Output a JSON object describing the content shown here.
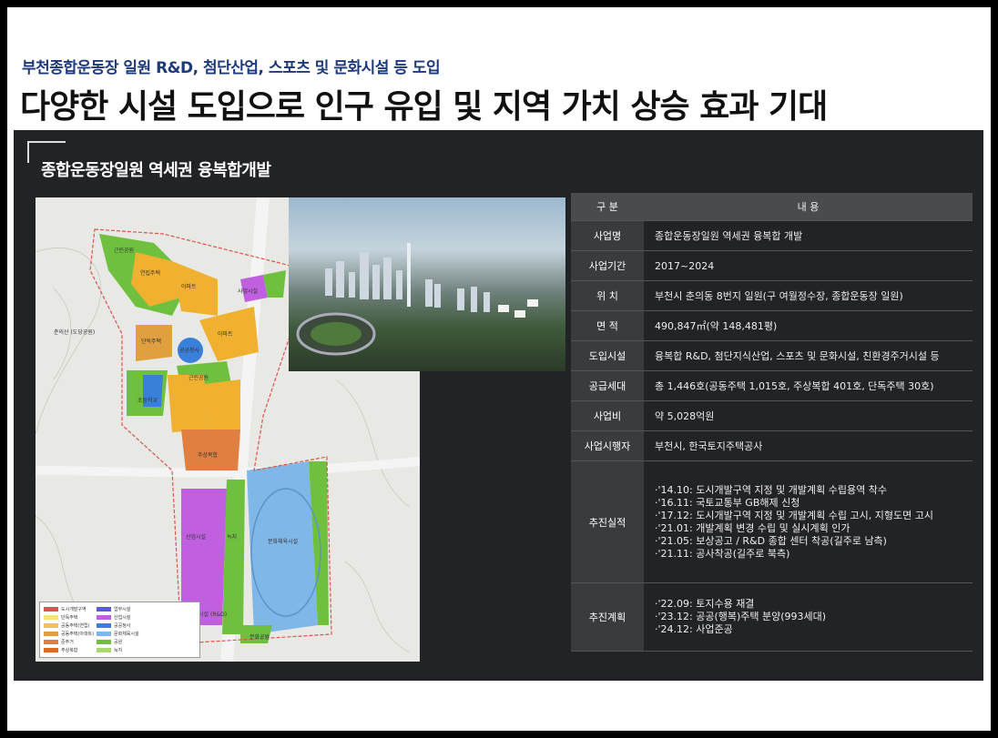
{
  "header": {
    "subtitle": "부천종합운동장 일원 R&D, 첨단산업, 스포츠 및 문화시설 등 도입",
    "title": "다양한 시설 도입으로 인구 유입 및 지역 가치 상승 효과 기대"
  },
  "section": {
    "title": "종합운동장일원 역세권 융복합개발"
  },
  "map": {
    "labels": {
      "park1": "근린공원",
      "house1": "연립주택",
      "apt1": "아파트",
      "res": "사업시설",
      "detached": "단독주택",
      "apt2": "아파트",
      "public1": "공공청사",
      "park2": "근린공원",
      "school": "초등학교",
      "mixed": "주상복합",
      "cheon_ui": "춘의산\n(도당공원)",
      "industry": "산업시설",
      "green": "녹지",
      "sports": "문화체육시설",
      "industry2": "산업시설\n(R&D)",
      "park3": "문화공원"
    },
    "legend": [
      {
        "label": "도시개발구역",
        "color": "#d9534f"
      },
      {
        "label": "단독주택",
        "color": "#f5e57a"
      },
      {
        "label": "공동주택(연립)",
        "color": "#f0c060"
      },
      {
        "label": "공동주택(아파트)",
        "color": "#e0a040"
      },
      {
        "label": "준주거",
        "color": "#e08040"
      },
      {
        "label": "주상복합",
        "color": "#d96a2a"
      },
      {
        "label": "업무시설",
        "color": "#5a5ad9"
      },
      {
        "label": "산업시설",
        "color": "#c060e0"
      },
      {
        "label": "공공청사",
        "color": "#3a7fd9"
      },
      {
        "label": "문화체육시설",
        "color": "#7fb8e8"
      },
      {
        "label": "공원",
        "color": "#70c040"
      },
      {
        "label": "녹지",
        "color": "#a8d870"
      }
    ]
  },
  "table": {
    "header": {
      "key": "구 분",
      "value": "내 용"
    },
    "rows": [
      {
        "key": "사업명",
        "value": "종합운동장일원 역세권 융복합 개발"
      },
      {
        "key": "사업기간",
        "value": "2017~2024"
      },
      {
        "key": "위 치",
        "value": "부천시 춘의동 8번지 일원(구 여월정수장, 종합운동장 일원)"
      },
      {
        "key": "면 적",
        "value": "490,847㎡(약 148,481평)"
      },
      {
        "key": "도입시설",
        "value": "융복합 R&D, 첨단지식산업, 스포츠 및 문화시설, 친환경주거시설 등"
      },
      {
        "key": "공급세대",
        "value": "총 1,446호(공동주택 1,015호, 주상복합 401호, 단독주택 30호)"
      },
      {
        "key": "사업비",
        "value": "약 5,028억원"
      },
      {
        "key": "사업시행자",
        "value": "부천시, 한국토지주택공사"
      }
    ],
    "progress": {
      "key": "추진실적",
      "items": [
        "·'14.10: 도시개발구역 지정 및 개발계획 수립용역 착수",
        "·'16.11: 국토교통부 GB해제 신청",
        "·'17.12: 도시개발구역 지정 및 개발계획 수립 고시, 지형도면 고시",
        "·'21.01: 개발계획 변경 수립 및 실시계획 인가",
        "·'21.05: 보상공고 / R&D 종합 센터 착공(길주로 남측)",
        "·'21.11: 공사착공(길주로 북측)"
      ]
    },
    "plan": {
      "key": "추진계획",
      "items": [
        "·'22.09: 토지수용 재결",
        "·'23.12: 공공(행복)주택 분양(993세대)",
        "·'24.12: 사업준공"
      ]
    }
  }
}
